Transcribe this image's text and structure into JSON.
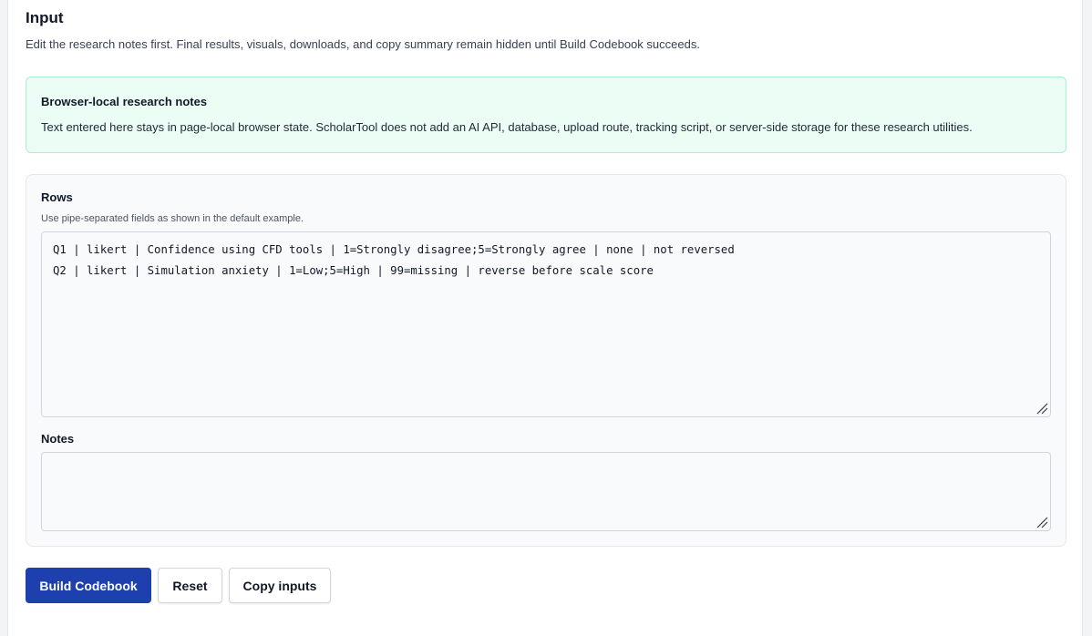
{
  "section": {
    "title": "Input",
    "description": "Edit the research notes first. Final results, visuals, downloads, and copy summary remain hidden until Build Codebook succeeds."
  },
  "notice": {
    "title": "Browser-local research notes",
    "text": "Text entered here stays in page-local browser state. ScholarTool does not add an AI API, database, upload route, tracking script, or server-side storage for these research utilities."
  },
  "form": {
    "rows_label": "Rows",
    "rows_hint": "Use pipe-separated fields as shown in the default example.",
    "rows_lines": [
      "Q1 | likert | Confidence using CFD tools | 1=Strongly disagree;5=Strongly agree | none | not reversed",
      "Q2 | likert | Simulation anxiety | 1=Low;5=High | 99=missing | reverse before scale score"
    ],
    "notes_label": "Notes",
    "notes_value": ""
  },
  "actions": {
    "build_label": "Build Codebook",
    "reset_label": "Reset",
    "copy_label": "Copy inputs"
  },
  "colors": {
    "primary": "#1e40af",
    "notice_bg": "#ecfdf5",
    "notice_border": "#a7f3d0"
  },
  "icons": {
    "resize": "resize-grip-icon"
  }
}
